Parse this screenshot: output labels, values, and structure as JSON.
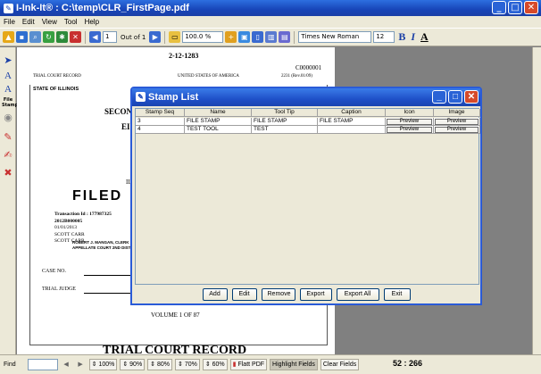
{
  "window": {
    "title": "I-Ink-It® : C:\\temp\\CLR_FirstPage.pdf"
  },
  "menu": [
    "File",
    "Edit",
    "View",
    "Tool",
    "Help"
  ],
  "toolbar": {
    "page_number": "1",
    "page_count_label": "Out of 1",
    "zoom": "100.0 %",
    "font_name": "Times New Roman",
    "font_size": "12",
    "bold_label": "B",
    "italic_label": "I",
    "font_color_label": "A"
  },
  "left_tools": {
    "file_stamp_label": "File Stamp"
  },
  "document": {
    "case_number_top": "2-12-1283",
    "doc_code": "C0000001",
    "trial_court_record_small": "TRIAL COURT RECORD",
    "united_states": "UNITED STATES OF AMERICA",
    "rev_code": "2231 (Rev.01/09)",
    "state": "STATE OF ILLINOIS",
    "secon": "SECON",
    "ei": "EI",
    "il": "IL",
    "filed": "FILED",
    "transaction": "Transaction Id : 177987325",
    "stamp_code": "2012B000005",
    "date": "01/01/2013",
    "name1": "SCOTT CARR",
    "name2": "SCOTT CARR",
    "clerk_line1": "ROBERT J. MANGAN, CLERK",
    "clerk_line2": "APPELLATE COURT 2ND DISTRICT",
    "case_no_label": "CASE NO.",
    "trial_judge_label": "TRIAL JUDGE",
    "volume": "VOLUME 1 OF 87",
    "big_title": "TRIAL COURT RECORD"
  },
  "dialog": {
    "title": "Stamp List",
    "columns": [
      "Stamp Seq",
      "Name",
      "Tool Tip",
      "Caption",
      "Icon",
      "Image"
    ],
    "rows": [
      {
        "seq": "3",
        "name": "FILE STAMP",
        "tooltip": "FILE STAMP",
        "caption": "FILE STAMP",
        "icon": "Preview",
        "image": "Preview"
      },
      {
        "seq": "4",
        "name": "TEST TOOL",
        "tooltip": "TEST",
        "caption": "",
        "icon": "Preview",
        "image": "Preview"
      }
    ],
    "buttons": {
      "add": "Add",
      "edit": "Edit",
      "remove": "Remove",
      "export": "Export",
      "export_all": "Export All",
      "exit": "Exit"
    }
  },
  "statusbar": {
    "find_label": "Find",
    "zoom_presets": [
      "100%",
      "90%",
      "80%",
      "70%",
      "60%"
    ],
    "flatten_pdf": "Flatt PDF",
    "highlight_fields": "Highlight Fields",
    "clear_fields": "Clear Fields",
    "coords": "52 : 266"
  }
}
